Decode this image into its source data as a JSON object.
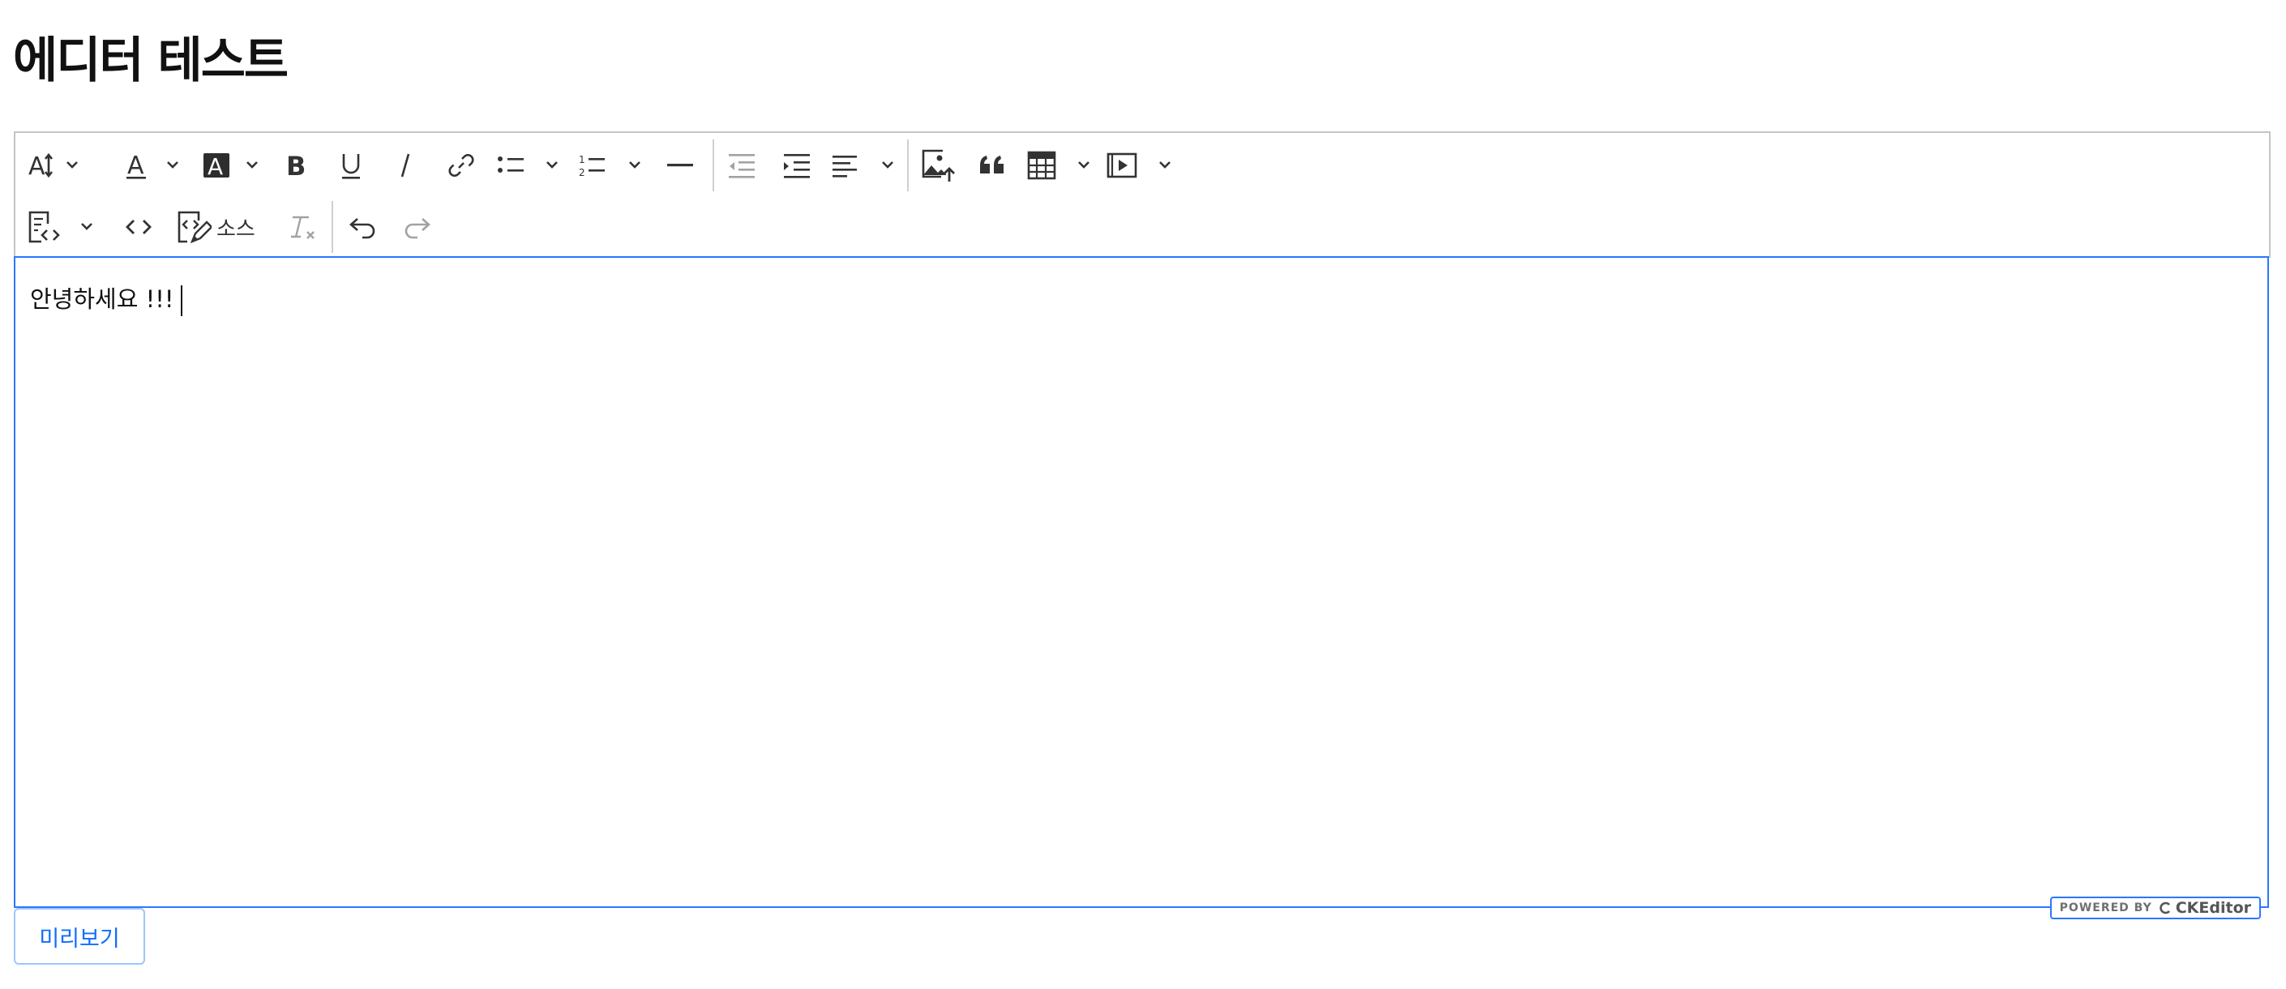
{
  "page": {
    "title": "에디터 테스트"
  },
  "toolbar": {
    "source_label": "소스",
    "buttons": [
      {
        "name": "font-size-dropdown",
        "icon": "font-size-icon",
        "dropdown": true
      },
      {
        "name": "font-color-dropdown",
        "icon": "font-color-icon",
        "dropdown": true
      },
      {
        "name": "font-background-color-dropdown",
        "icon": "font-background-icon",
        "dropdown": true
      },
      {
        "name": "bold-button",
        "icon": "bold-icon"
      },
      {
        "name": "underline-button",
        "icon": "underline-icon"
      },
      {
        "name": "italic-button",
        "icon": "italic-icon"
      },
      {
        "name": "link-button",
        "icon": "link-icon"
      },
      {
        "name": "bulleted-list-dropdown",
        "icon": "bulleted-list-icon",
        "dropdown": true
      },
      {
        "name": "numbered-list-dropdown",
        "icon": "numbered-list-icon",
        "dropdown": true
      },
      {
        "name": "horizontal-line-button",
        "icon": "horizontal-line-icon"
      },
      {
        "name": "outdent-button",
        "icon": "outdent-icon",
        "disabled": true
      },
      {
        "name": "indent-button",
        "icon": "indent-icon"
      },
      {
        "name": "alignment-dropdown",
        "icon": "align-left-icon",
        "dropdown": true
      },
      {
        "name": "insert-image-button",
        "icon": "image-upload-icon"
      },
      {
        "name": "block-quote-button",
        "icon": "quote-icon"
      },
      {
        "name": "insert-table-dropdown",
        "icon": "table-icon",
        "dropdown": true
      },
      {
        "name": "insert-media-dropdown",
        "icon": "media-icon",
        "dropdown": true
      },
      {
        "name": "code-block-dropdown",
        "icon": "code-block-icon",
        "dropdown": true
      },
      {
        "name": "inline-code-button",
        "icon": "code-icon"
      },
      {
        "name": "source-editing-button",
        "icon": "source-edit-icon"
      },
      {
        "name": "remove-format-button",
        "icon": "remove-format-icon",
        "disabled": true
      },
      {
        "name": "undo-button",
        "icon": "undo-icon"
      },
      {
        "name": "redo-button",
        "icon": "redo-icon",
        "disabled": true
      }
    ]
  },
  "editor": {
    "content": "안녕하세요 !!!"
  },
  "badge": {
    "powered_by": "POWERED BY",
    "brand": "CKEditor"
  },
  "preview_button": {
    "label": "미리보기"
  },
  "colors": {
    "focus_border": "#2977ff",
    "toolbar_border": "#c4c4c4",
    "primary": "#0d6efd"
  }
}
